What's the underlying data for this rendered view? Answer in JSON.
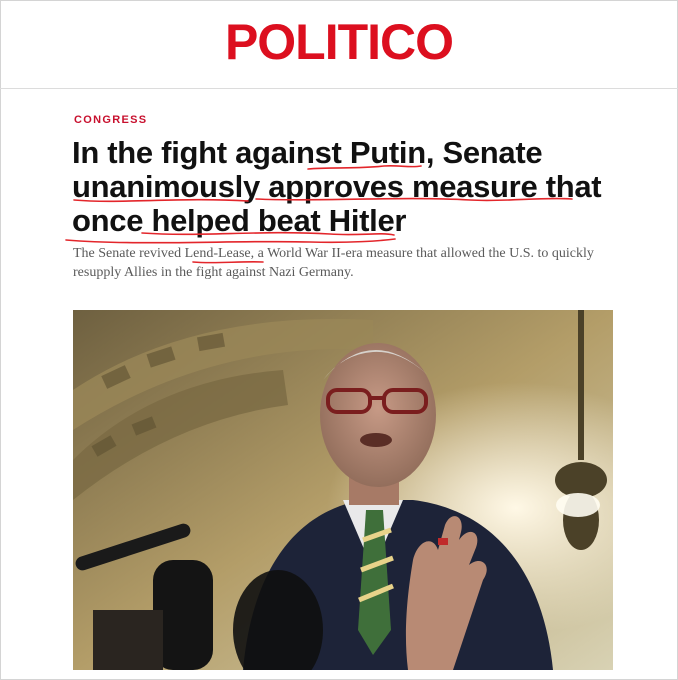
{
  "site": {
    "logo": "POLITICO",
    "brand_color": "#dc0f1f"
  },
  "article": {
    "section": "CONGRESS",
    "headline": "In the fight against Putin, Senate unanimously approves measure that once helped beat Hitler",
    "dek": "The Senate revived Lend-Lease, a World War II-era measure that allowed the U.S. to quickly resupply Allies in the fight against Nazi Germany."
  },
  "annotation": {
    "color": "#e3262b"
  },
  "image": {
    "subject": "man-with-glasses-speaking-at-microphones"
  }
}
